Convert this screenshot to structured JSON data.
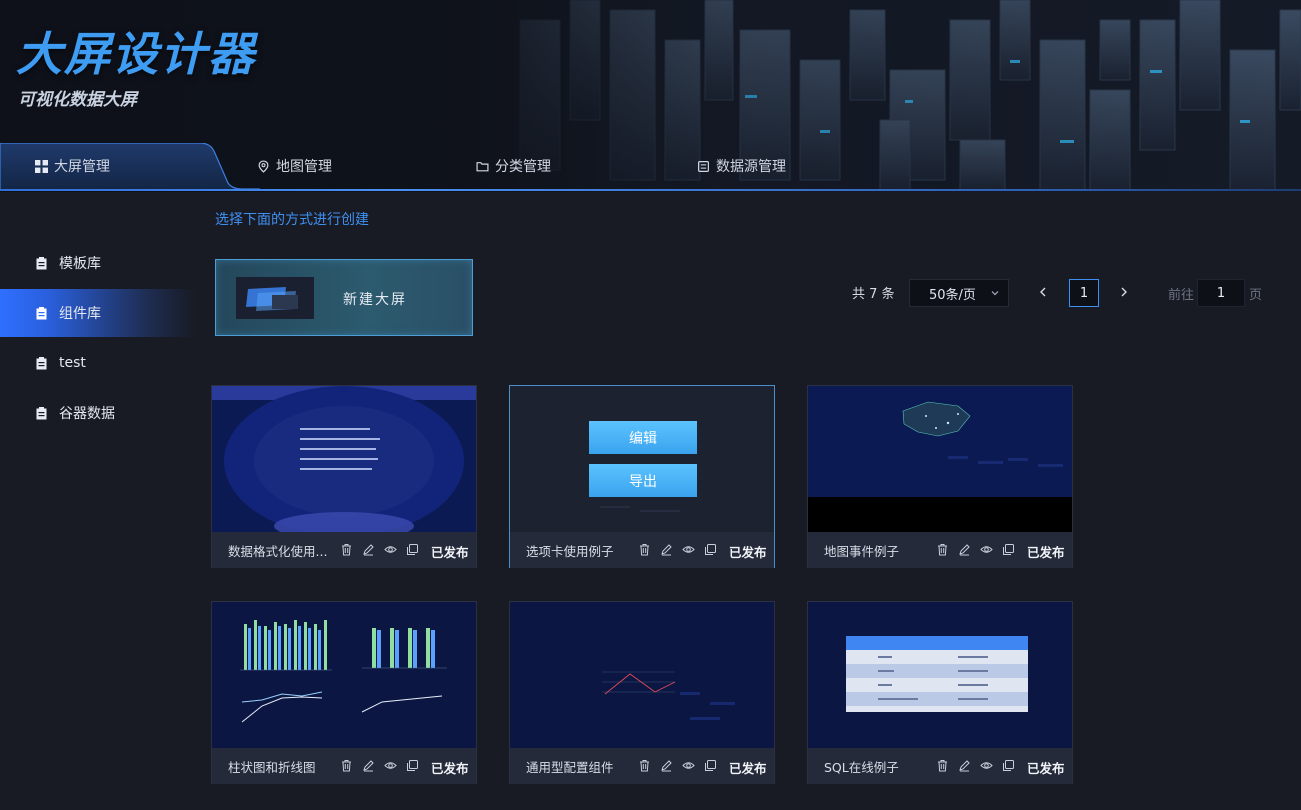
{
  "app": {
    "title": "大屏设计器",
    "subtitle": "可视化数据大屏"
  },
  "nav": {
    "items": [
      {
        "label": "大屏管理",
        "icon": "grid-icon",
        "active": true
      },
      {
        "label": "地图管理",
        "icon": "map-pin-icon"
      },
      {
        "label": "分类管理",
        "icon": "folder-icon"
      },
      {
        "label": "数据源管理",
        "icon": "database-icon"
      }
    ]
  },
  "sidebar": {
    "items": [
      {
        "label": "模板库",
        "icon": "clipboard-icon"
      },
      {
        "label": "组件库",
        "icon": "clipboard-icon",
        "active": true
      },
      {
        "label": "test",
        "icon": "clipboard-icon"
      },
      {
        "label": "谷器数据",
        "icon": "clipboard-icon"
      }
    ]
  },
  "main": {
    "hint": "选择下面的方式进行创建",
    "new_label": "新建大屏"
  },
  "pagination": {
    "total": "共 7 条",
    "page_size": "50条/页",
    "current_page": "1",
    "goto_label": "前往",
    "goto_value": "1",
    "goto_unit": "页"
  },
  "overlay": {
    "edit_label": "编辑",
    "export_label": "导出"
  },
  "cards": [
    {
      "name": "数据格式化使用...",
      "status": "已发布"
    },
    {
      "name": "选项卡使用例子",
      "status": "已发布"
    },
    {
      "name": "地图事件例子",
      "status": "已发布"
    },
    {
      "name": "柱状图和折线图",
      "status": "已发布"
    },
    {
      "name": "通用型配置组件",
      "status": "已发布"
    },
    {
      "name": "SQL在线例子",
      "status": "已发布"
    }
  ],
  "colors": {
    "accent": "#3e9cf3",
    "background": "#181b24",
    "card": "#22283a",
    "active_side": "#2f6fff"
  }
}
